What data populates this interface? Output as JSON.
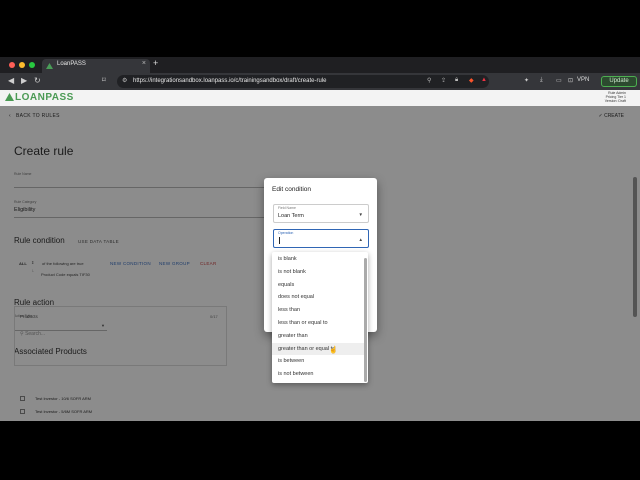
{
  "browser": {
    "tab_title": "LoanPASS",
    "tab_close": "×",
    "new_tab": "+",
    "url": "https://integrationsandbox.loanpass.io/c/trainingsandbox/draft/create-rule",
    "vpn": "VPN",
    "update_label": "Update",
    "traffic_lights": [
      "#ff5f57",
      "#febc2e",
      "#28c840"
    ]
  },
  "app": {
    "logo": "LOANPASS",
    "user_info": [
      "Rule Admin",
      "Pricing Tier 1",
      "Version: Draft"
    ]
  },
  "page": {
    "back_label": "BACK TO RULES",
    "create_label": "CREATE",
    "title": "Create rule",
    "rule_name_label": "Rule Name",
    "rule_category_label": "Rule Category",
    "rule_category_value": "Eligibility",
    "rule_condition_heading": "Rule condition",
    "use_data_table": "USE DATA TABLE",
    "all_label": "ALL",
    "condition_text": "of the following are true",
    "new_condition": "NEW CONDITION",
    "new_group": "NEW GROUP",
    "clear": "CLEAR",
    "condition_line": "Product Code equals TIF30",
    "rule_action_heading": "Rule action",
    "action_type_label": "Action Type",
    "associated_products_heading": "Associated Products",
    "products_header": "Products",
    "products_count": "0/17",
    "search_placeholder": "Search...",
    "products": [
      "Test Investor - 10/6 SOFR ARM",
      "Test Investor - 5/6M SOFR ARM"
    ]
  },
  "modal": {
    "title": "Edit condition",
    "field_name_label": "Field Name",
    "field_name_value": "Loan Term",
    "operation_label": "Operation",
    "options": [
      "is blank",
      "is not blank",
      "equals",
      "does not equal",
      "less than",
      "less than or equal to",
      "greater than",
      "greater than or equal to",
      "is between",
      "is not between"
    ],
    "highlighted_option": "greater than or equal to"
  }
}
